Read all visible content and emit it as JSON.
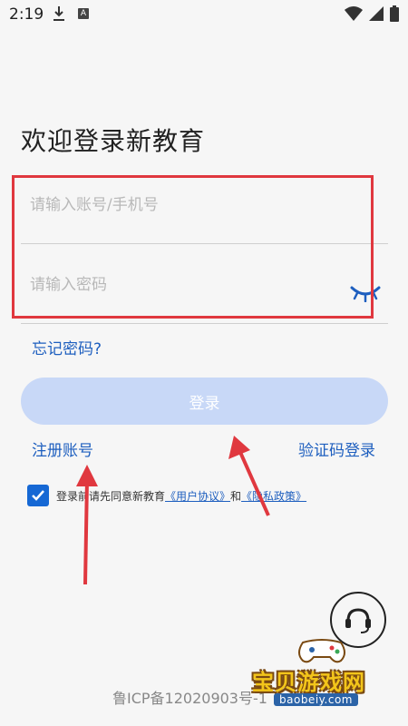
{
  "status": {
    "time": "2:19",
    "a_icon": "A",
    "icons": [
      "download-icon",
      "a-box-icon",
      "wifi-icon",
      "signal-icon",
      "battery-icon"
    ]
  },
  "login": {
    "title": "欢迎登录新教育",
    "username_placeholder": "请输入账号/手机号",
    "password_placeholder": "请输入密码",
    "forgot_password": "忘记密码?",
    "login_button": "登录",
    "register": "注册账号",
    "sms_login": "验证码登录"
  },
  "agreement": {
    "prefix": "登录前请先同意新教育",
    "user_agreement": "《用户协议》",
    "and": "和",
    "privacy_policy": "《隐私政策》"
  },
  "footer": {
    "icp": "鲁ICP备12020903号-1",
    "support_icon": "headset-icon"
  },
  "watermark": {
    "title": "宝贝游戏网",
    "domain": "baobeiy.com"
  },
  "colors": {
    "link": "#1e5fbf",
    "login_button": "#c8d8f7",
    "checkbox": "#1668d4",
    "highlight": "#e0383f",
    "arrow": "#e0383f"
  }
}
